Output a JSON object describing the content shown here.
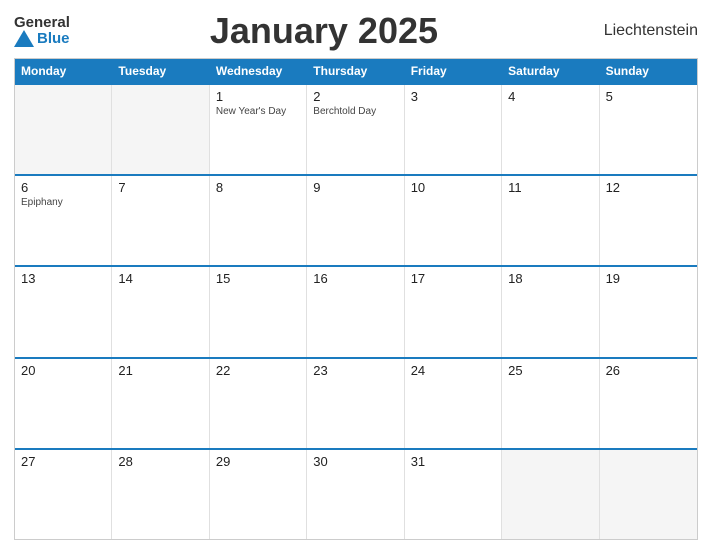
{
  "header": {
    "logo_general": "General",
    "logo_blue": "Blue",
    "title": "January 2025",
    "country": "Liechtenstein"
  },
  "calendar": {
    "days_of_week": [
      "Monday",
      "Tuesday",
      "Wednesday",
      "Thursday",
      "Friday",
      "Saturday",
      "Sunday"
    ],
    "weeks": [
      [
        {
          "num": "",
          "event": "",
          "empty": true
        },
        {
          "num": "",
          "event": "",
          "empty": true
        },
        {
          "num": "1",
          "event": "New Year's Day",
          "empty": false
        },
        {
          "num": "2",
          "event": "Berchtold Day",
          "empty": false
        },
        {
          "num": "3",
          "event": "",
          "empty": false
        },
        {
          "num": "4",
          "event": "",
          "empty": false
        },
        {
          "num": "5",
          "event": "",
          "empty": false
        }
      ],
      [
        {
          "num": "6",
          "event": "Epiphany",
          "empty": false
        },
        {
          "num": "7",
          "event": "",
          "empty": false
        },
        {
          "num": "8",
          "event": "",
          "empty": false
        },
        {
          "num": "9",
          "event": "",
          "empty": false
        },
        {
          "num": "10",
          "event": "",
          "empty": false
        },
        {
          "num": "11",
          "event": "",
          "empty": false
        },
        {
          "num": "12",
          "event": "",
          "empty": false
        }
      ],
      [
        {
          "num": "13",
          "event": "",
          "empty": false
        },
        {
          "num": "14",
          "event": "",
          "empty": false
        },
        {
          "num": "15",
          "event": "",
          "empty": false
        },
        {
          "num": "16",
          "event": "",
          "empty": false
        },
        {
          "num": "17",
          "event": "",
          "empty": false
        },
        {
          "num": "18",
          "event": "",
          "empty": false
        },
        {
          "num": "19",
          "event": "",
          "empty": false
        }
      ],
      [
        {
          "num": "20",
          "event": "",
          "empty": false
        },
        {
          "num": "21",
          "event": "",
          "empty": false
        },
        {
          "num": "22",
          "event": "",
          "empty": false
        },
        {
          "num": "23",
          "event": "",
          "empty": false
        },
        {
          "num": "24",
          "event": "",
          "empty": false
        },
        {
          "num": "25",
          "event": "",
          "empty": false
        },
        {
          "num": "26",
          "event": "",
          "empty": false
        }
      ],
      [
        {
          "num": "27",
          "event": "",
          "empty": false
        },
        {
          "num": "28",
          "event": "",
          "empty": false
        },
        {
          "num": "29",
          "event": "",
          "empty": false
        },
        {
          "num": "30",
          "event": "",
          "empty": false
        },
        {
          "num": "31",
          "event": "",
          "empty": false
        },
        {
          "num": "",
          "event": "",
          "empty": true
        },
        {
          "num": "",
          "event": "",
          "empty": true
        }
      ]
    ]
  }
}
